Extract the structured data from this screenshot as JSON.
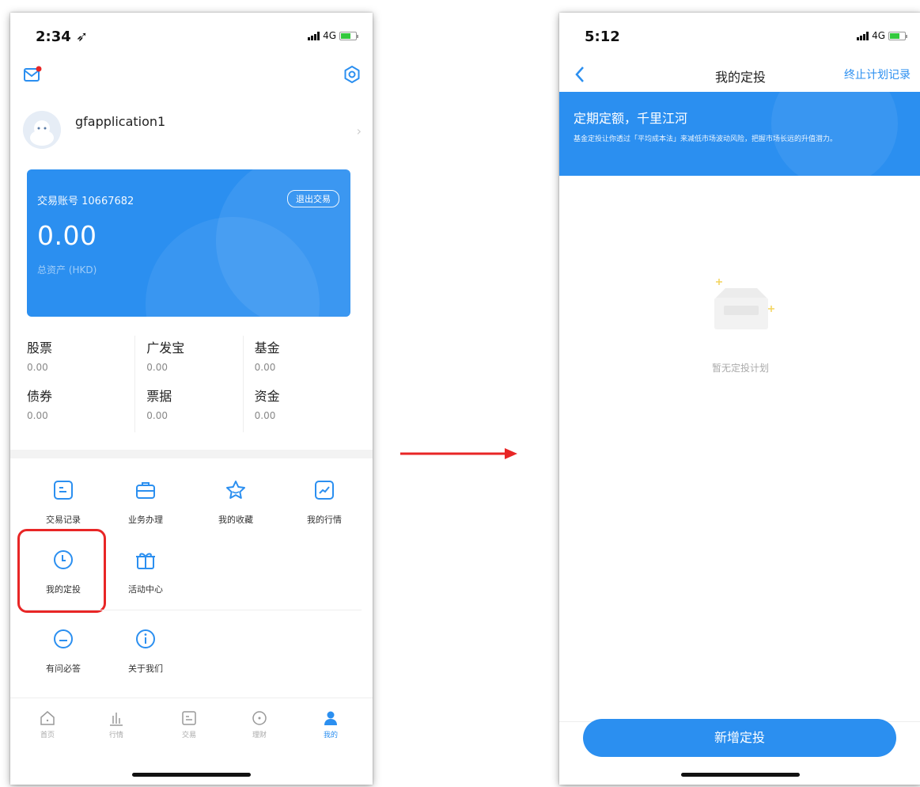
{
  "left_screen": {
    "status": {
      "time": "2:34",
      "network": "4G"
    },
    "profile": {
      "username": "gfapplication1"
    },
    "account_card": {
      "account_label": "交易账号 10667682",
      "exit_button": "退出交易",
      "balance": "0.00",
      "total_label": "总资产 (HKD)"
    },
    "assets": [
      {
        "name": "股票",
        "value": "0.00"
      },
      {
        "name": "广发宝",
        "value": "0.00"
      },
      {
        "name": "基金",
        "value": "0.00"
      },
      {
        "name": "债券",
        "value": "0.00"
      },
      {
        "name": "票据",
        "value": "0.00"
      },
      {
        "name": "资金",
        "value": "0.00"
      }
    ],
    "menu": [
      {
        "label": "交易记录",
        "icon": "record-icon"
      },
      {
        "label": "业务办理",
        "icon": "briefcase-icon"
      },
      {
        "label": "我的收藏",
        "icon": "star-icon"
      },
      {
        "label": "我的行情",
        "icon": "chart-icon"
      },
      {
        "label": "我的定投",
        "icon": "clock-icon"
      },
      {
        "label": "活动中心",
        "icon": "gift-icon"
      },
      {
        "label": "有问必答",
        "icon": "chat-icon"
      },
      {
        "label": "关于我们",
        "icon": "info-icon"
      }
    ],
    "tabs": [
      {
        "label": "首页",
        "icon": "home-icon"
      },
      {
        "label": "行情",
        "icon": "bars-icon"
      },
      {
        "label": "交易",
        "icon": "trade-icon"
      },
      {
        "label": "理财",
        "icon": "wealth-icon"
      },
      {
        "label": "我的",
        "icon": "person-icon"
      }
    ],
    "accent_color": "#2b8ff0",
    "highlight_color": "#e82626"
  },
  "right_screen": {
    "status": {
      "time": "5:12",
      "network": "4G"
    },
    "nav": {
      "title": "我的定投",
      "link": "终止计划记录"
    },
    "banner": {
      "title": "定期定额，千里江河",
      "desc": "基金定投让你透过「平均成本法」来减低市场波动风险，把握市场长远的升值潜力。"
    },
    "empty_text": "暂无定投计划",
    "add_button": "新增定投"
  }
}
